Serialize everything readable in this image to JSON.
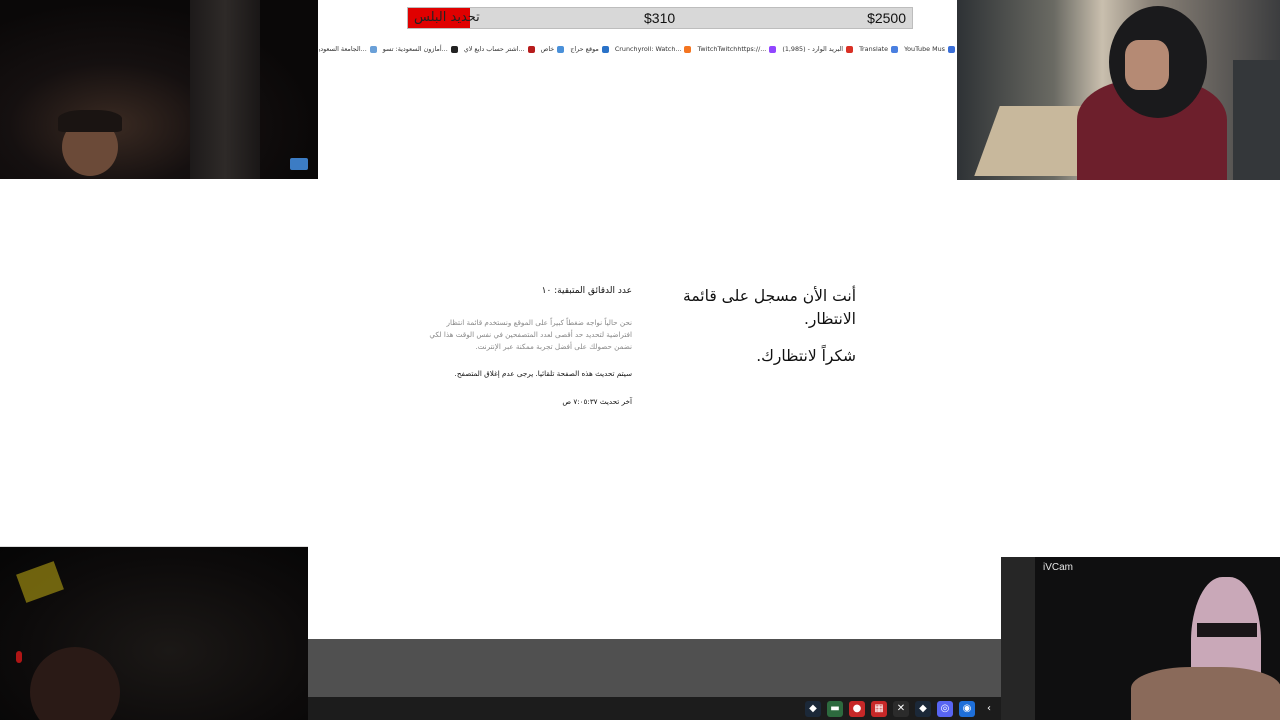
{
  "goal": {
    "label": "تحديد البلس",
    "current": "$310",
    "target": "$2500",
    "progress_fraction": 0.124,
    "fill_color": "#e00000"
  },
  "bookmarks": [
    {
      "label": "YouTube Mus",
      "icon": "youtube-icon",
      "color": "#3b6fd8"
    },
    {
      "label": "Translate",
      "icon": "translate-icon",
      "color": "#4a7fe0"
    },
    {
      "label": "البريد الوارد - (1,985)",
      "icon": "gmail-icon",
      "color": "#d93025"
    },
    {
      "label": "TwitchTwitchhttps://...",
      "icon": "twitch-icon",
      "color": "#9146ff"
    },
    {
      "label": "Crunchyroll: Watch...",
      "icon": "crunchyroll-icon",
      "color": "#f47521"
    },
    {
      "label": "موقع حراج",
      "icon": "haraj-icon",
      "color": "#2a72c8"
    },
    {
      "label": "خاص",
      "icon": "private-icon",
      "color": "#4a90d9"
    },
    {
      "label": "اشتر حساب دايع لاي...",
      "icon": "store-icon",
      "color": "#b71c1c"
    },
    {
      "label": "أمازون السعودية: تسو...",
      "icon": "amazon-icon",
      "color": "#222222"
    },
    {
      "label": "الجامعة السعودية الإل...",
      "icon": "university-icon",
      "color": "#6aa0d8"
    },
    {
      "label": "",
      "icon": "bookmark-icon",
      "color": "#3a8d3a"
    }
  ],
  "waiting": {
    "title": "أنت الأن مسجل على قائمة الانتظار.",
    "thanks": "شكراً لانتظارك.",
    "minutes_remaining": "عدد الدقائق المتبقية: ١٠",
    "paragraph": "نحن حالياً نواجه ضغطاً كبيراً على الموقع ونستخدم قائمة انتظار افتراضية لتحديد حد أقصى لعدد المتصفحين في نفس الوقت هذا لكي نضمن حصولك على أفضل تجربة ممكنة عبر الإنترنت.",
    "refresh_note": "سيتم تحديث هذه الصفحة تلقائيا. يرجى عدم إغلاق المتصفح.",
    "last_updated": "آخر تحديث ٧:٠٥:٣٧ ص"
  },
  "cams": {
    "bottom_right_label": "iVCam"
  },
  "taskbar": [
    {
      "icon": "steam-icon",
      "glyph": "◆",
      "color": "#1b2838"
    },
    {
      "icon": "app-icon",
      "glyph": "▬",
      "color": "#2d6a3e"
    },
    {
      "icon": "record-icon",
      "glyph": "●",
      "color": "#c62828"
    },
    {
      "icon": "calendar-icon",
      "glyph": "▦",
      "color": "#c62828"
    },
    {
      "icon": "epic-icon",
      "glyph": "✕",
      "color": "#2b2b2b"
    },
    {
      "icon": "steam-icon",
      "glyph": "◆",
      "color": "#1b2838"
    },
    {
      "icon": "discord-icon",
      "glyph": "◎",
      "color": "#5865f2"
    },
    {
      "icon": "app-blue-icon",
      "glyph": "◉",
      "color": "#1e6fd9"
    },
    {
      "icon": "chevron-icon",
      "glyph": "‹",
      "color": "#1c1c1c"
    }
  ]
}
